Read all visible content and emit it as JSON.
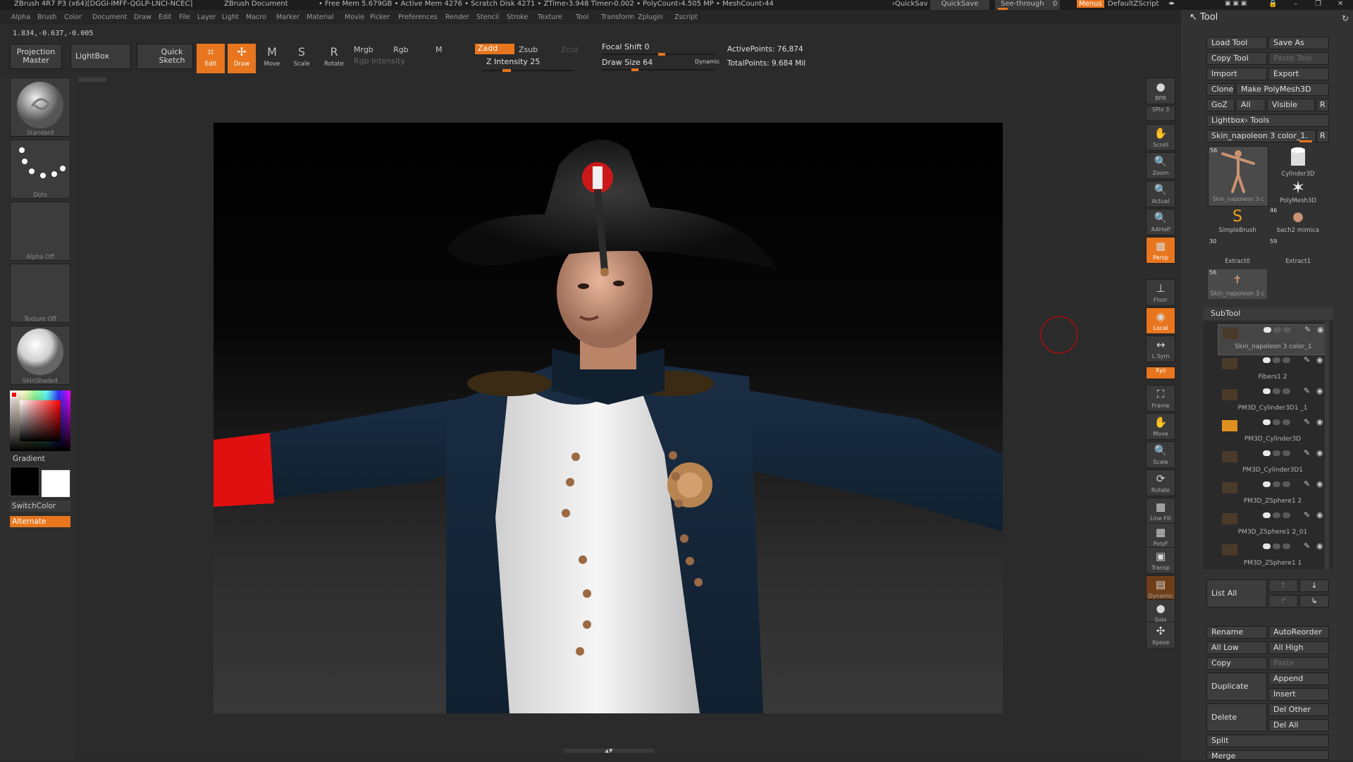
{
  "app": {
    "title": "ZBrush 4R7 P3 (x64)[DGGI-IMFF-QGLP-LNCI-NCEC]",
    "document": "ZBrush Document",
    "stats": "• Free Mem 5.679GB • Active Mem 4276 • Scratch Disk 4271 • ZTime›3.948 Timer›0.002 • PolyCount›4.505 MP • MeshCount›44",
    "quicksave_hint": "›QuickSav",
    "quicksave": "QuickSave",
    "see_through": "See-through",
    "see_through_value": "0",
    "menus": "Menus",
    "script": "DefaultZScript"
  },
  "menu": [
    "Alpha",
    "Brush",
    "Color",
    "Document",
    "Draw",
    "Edit",
    "File",
    "Layer",
    "Light",
    "Macro",
    "Marker",
    "Material",
    "Movie",
    "Picker",
    "Preferences",
    "Render",
    "Stencil",
    "Stroke",
    "Texture",
    "Tool",
    "Transform",
    "Zplugin",
    "Zscript"
  ],
  "coords": "1.834,-0.637,-0.005",
  "shelf": {
    "projection_master": "Projection Master",
    "lightbox": "LightBox",
    "quick_sketch": "Quick Sketch",
    "edit": "Edit",
    "draw": "Draw",
    "move": "Move",
    "scale": "Scale",
    "rotate": "Rotate",
    "mrgb": "Mrgb",
    "rgb": "Rgb",
    "m": "M",
    "rgb_intensity": "Rgb Intensity",
    "zadd": "Zadd",
    "zsub": "Zsub",
    "zcut": "Zcut",
    "z_intensity": "Z Intensity 25",
    "z_intensity_value": 25,
    "focal_shift": "Focal Shift 0",
    "focal_shift_value": 0,
    "draw_size": "Draw Size 64",
    "draw_size_value": 64,
    "dynamic": "Dynamic",
    "active_points": "ActivePoints: 76,874",
    "total_points": "TotalPoints: 9.684 Mil"
  },
  "left": {
    "brush": "Standard",
    "stroke": "Dots",
    "alpha": "Alpha Off",
    "texture": "Texture Off",
    "material": "SkinShade4",
    "gradient": "Gradient",
    "switch_color": "SwitchColor",
    "alternate": "Alternate"
  },
  "strip": [
    {
      "label": "BPR",
      "icon": "bpr-icon"
    },
    {
      "label": "SPix 3",
      "icon": "spix-icon"
    },
    {
      "label": "Scroll",
      "icon": "scroll-icon"
    },
    {
      "label": "Zoom",
      "icon": "zoom-icon"
    },
    {
      "label": "Actual",
      "icon": "actual-icon"
    },
    {
      "label": "AAHalf",
      "icon": "aahalf-icon"
    },
    {
      "label": "Persp",
      "top": "Dynamic",
      "icon": "persp-icon"
    },
    {
      "label": "Floor",
      "icon": "floor-icon"
    },
    {
      "label": "Local",
      "icon": "local-icon"
    },
    {
      "label": "L.Sym",
      "icon": "lsym-icon"
    },
    {
      "label": "Xyz",
      "icon": "xyz-icon"
    },
    {
      "label": "Frame",
      "icon": "frame-icon"
    },
    {
      "label": "Move",
      "icon": "move-icon"
    },
    {
      "label": "Scale",
      "icon": "scale-icon"
    },
    {
      "label": "Rotate",
      "icon": "rotate-icon"
    },
    {
      "label": "Line Fill",
      "icon": "linefill-icon"
    },
    {
      "label": "PolyF",
      "icon": "polyf-icon"
    },
    {
      "label": "Transp",
      "icon": "transp-icon"
    },
    {
      "label": "Dynamic",
      "icon": "ghost-icon"
    },
    {
      "label": "Solo",
      "icon": "solo-icon"
    },
    {
      "label": "Xpose",
      "icon": "xpose-icon"
    }
  ],
  "tool": {
    "title": "Tool",
    "load_tool": "Load Tool",
    "save_as": "Save As",
    "copy_tool": "Copy Tool",
    "paste_tool": "Paste Tool",
    "import": "Import",
    "export": "Export",
    "clone": "Clone",
    "make_polymesh": "Make PolyMesh3D",
    "goz": "GoZ",
    "all": "All",
    "visible": "Visible",
    "r": "R",
    "lightbox_tools": "Lightbox› Tools",
    "current_tool": "Skin_napoleon 3 color_1.",
    "thumbs": [
      {
        "name": "Skin_napoleon 3 c",
        "count": "56"
      },
      {
        "name": "Cylinder3D"
      },
      {
        "name": "PolyMesh3D"
      },
      {
        "name": "SimpleBrush"
      },
      {
        "name": "bach2 mimica",
        "count": "46"
      },
      {
        "name": "Extract0",
        "count": "30"
      },
      {
        "name": "Extract1",
        "count": "59"
      },
      {
        "name": "Skin_napoleon 3 c",
        "count": "56"
      }
    ]
  },
  "subtool": {
    "title": "SubTool",
    "items": [
      "Skin_napoleon 3 color_1",
      "Fibers1 2",
      "PM3D_Cylinder3D1 _1",
      "PM3D_Cylinder3D",
      "PM3D_Cylinder3D1",
      "PM3D_ZSphere1 2",
      "PM3D_ZSphere1 2_01",
      "PM3D_ZSphere1 1"
    ],
    "list_all": "List All",
    "rename": "Rename",
    "auto_reorder": "AutoReorder",
    "all_low": "All Low",
    "all_high": "All High",
    "copy": "Copy",
    "paste": "Paste",
    "append": "Append",
    "duplicate": "Duplicate",
    "insert": "Insert",
    "del_other": "Del Other",
    "delete": "Delete",
    "del_all": "Del All",
    "split": "Split",
    "merge": "Merge"
  },
  "colors": {
    "accent": "#e8761e",
    "panel": "#323232",
    "background": "#2a2a2a"
  }
}
